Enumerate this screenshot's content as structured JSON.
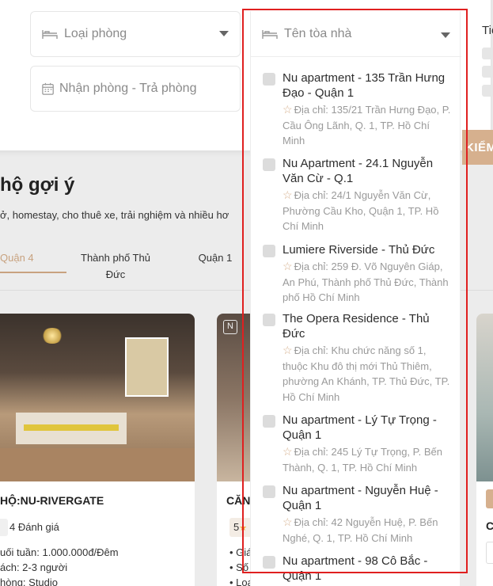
{
  "search": {
    "room_type": "Loại phòng",
    "dates": "Nhận phòng - Trả phòng",
    "right_label": "Tiệ",
    "button_label": "KIỂM"
  },
  "section": {
    "title": "hộ gợi ý",
    "subtitle": "ở, homestay, cho thuê xe, trải nghiệm và nhiều hơ",
    "tabs": [
      {
        "label": "Quận 4",
        "active": true
      },
      {
        "label": "Thành phố Thủ Đức",
        "active": false
      },
      {
        "label": "Quận 1",
        "active": false
      }
    ]
  },
  "cards": [
    {
      "title": "HỘ:NU-RIVERGATE",
      "rating": "4 Đánh giá",
      "lines": [
        "uối tuần: 1.000.000đ/Đêm",
        "ách: 2-3 người",
        "hòng: Studio"
      ]
    },
    {
      "title": "CĂN",
      "rating": "5",
      "lines": [
        "• Giá",
        "• Số l",
        "• Loạ"
      ]
    },
    {
      "title": "C"
    }
  ],
  "dropdown": {
    "placeholder": "Tên tòa nhà",
    "items": [
      {
        "name": "Nu apartment - 135 Trần Hưng Đạo - Quận 1",
        "address": "Địa chỉ: 135/21 Trần Hưng Đạo, P. Cầu Ông Lãnh, Q. 1, TP. Hồ Chí Minh"
      },
      {
        "name": "Nu Apartment - 24.1 Nguyễn Văn Cừ - Q.1",
        "address": "Địa chỉ: 24/1 Nguyễn Văn Cừ, Phường Cầu Kho, Quận 1, TP. Hồ Chí Minh"
      },
      {
        "name": "Lumiere Riverside - Thủ Đức",
        "address": "Địa chỉ: 259 Đ. Võ Nguyên Giáp, An Phú, Thành phố Thủ Đức, Thành phố Hồ Chí Minh"
      },
      {
        "name": "The Opera Residence - Thủ Đức",
        "address": "Địa chỉ: Khu chức năng số 1, thuộc Khu đô thị mới Thủ Thiêm, phường An Khánh, TP. Thủ Đức, TP. Hồ Chí Minh"
      },
      {
        "name": "Nu apartment - Lý Tự Trọng - Quận 1",
        "address": "Địa chỉ: 245 Lý Tự Trọng, P. Bến Thành, Q. 1, TP. Hồ Chí Minh"
      },
      {
        "name": "Nu apartment - Nguyễn Huệ - Quận 1",
        "address": "Địa chỉ: 42 Nguyễn Huệ, P. Bến Nghé, Q. 1, TP. Hồ Chí Minh"
      },
      {
        "name": "Nu apartment - 98 Cô Bắc - Quận 1",
        "address": ""
      }
    ]
  },
  "colors": {
    "accent": "#c8a27f",
    "highlight": "#e02020"
  }
}
